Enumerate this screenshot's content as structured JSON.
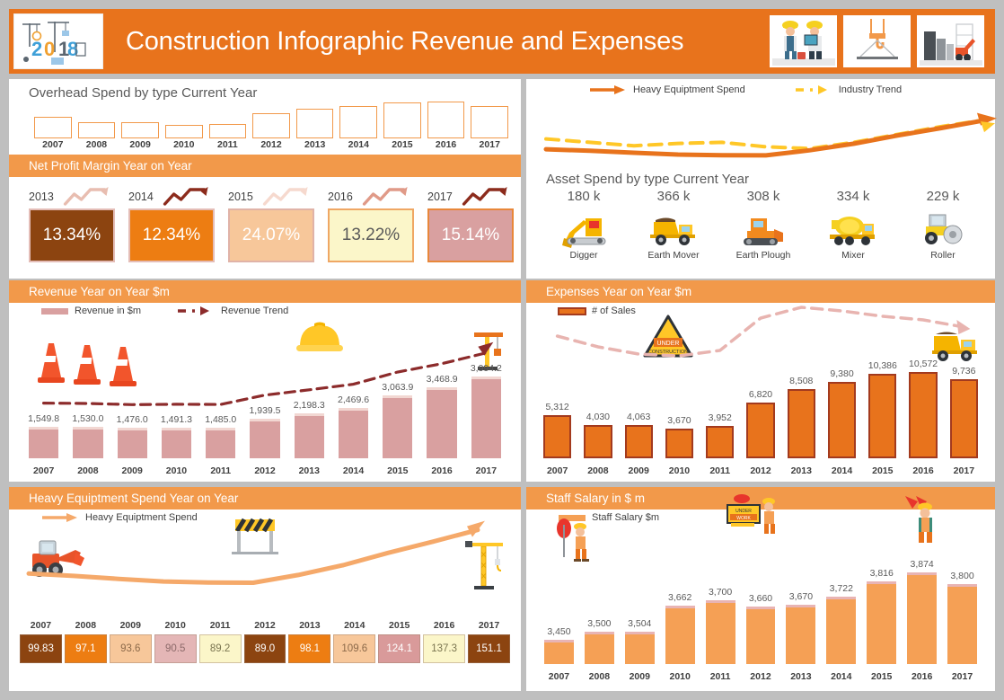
{
  "header": {
    "title": "Construction Infographic Revenue and Expenses",
    "logo_alt": "2018-construction-logo",
    "accent": "#E8731C",
    "thumbs": [
      {
        "name": "workers-blueprint-photo"
      },
      {
        "name": "crane-hook-photo"
      },
      {
        "name": "city-excavator-photo"
      }
    ]
  },
  "overhead": {
    "title": "Overhead Spend by type Current Year",
    "chart_data": {
      "type": "bar",
      "title": "Overhead Spend by type Current Year",
      "categories": [
        "2007",
        "2008",
        "2009",
        "2010",
        "2011",
        "2012",
        "2013",
        "2014",
        "2015",
        "2016",
        "2017"
      ],
      "values": [
        24,
        18,
        18,
        15,
        16,
        28,
        33,
        36,
        40,
        41,
        36
      ],
      "xlabel": "",
      "ylabel": "",
      "ylim": [
        0,
        42
      ],
      "grid": false,
      "legend": "none"
    }
  },
  "netprofit": {
    "band": "Net Profit Margin Year on Year",
    "chart_data": {
      "type": "heatmap",
      "title": "Net Profit Margin Year on Year",
      "categories": [
        "2013",
        "2014",
        "2015",
        "2016",
        "2017"
      ],
      "values": [
        13.34,
        12.34,
        24.07,
        13.22,
        15.14
      ],
      "labels": [
        "13.34%",
        "12.34%",
        "24.07%",
        "13.22%",
        "15.14%"
      ],
      "cell_colors": [
        "#8C4410",
        "#ED7D12",
        "#F7C79A",
        "#FBF6C9",
        "#D9A0A0"
      ],
      "text_colors": [
        "#ffffff",
        "#ffffff",
        "#ffffff",
        "#595959",
        "#ffffff"
      ],
      "border_colors": [
        "#E4BDB7",
        "#E4BDB7",
        "#E0B3A8",
        "#EFA764",
        "#E8873A"
      ],
      "arrow_colors": [
        "#E8BDB0",
        "#8C2B1C",
        "#F6D9CE",
        "#E09A88",
        "#8C2B1C"
      ]
    }
  },
  "trendpanel": {
    "legend": [
      {
        "label": "Heavy Equiptment Spend",
        "color": "#E8731C",
        "style": "solid-arrow"
      },
      {
        "label": "Industry Trend",
        "color": "#FFC727",
        "style": "dashed-arrow"
      }
    ],
    "chart_data": {
      "type": "line",
      "title": "",
      "series": [
        {
          "name": "Heavy Equiptment Spend",
          "color": "#E8731C",
          "style": "solid",
          "values": [
            99.83,
            97.1,
            93.6,
            90.5,
            89.2,
            89.0,
            98.1,
            109.6,
            124.1,
            137.3,
            151.1
          ]
        },
        {
          "name": "Industry Trend",
          "color": "#FFC727",
          "style": "dashed",
          "values": [
            118,
            112,
            106,
            110,
            112,
            104,
            101,
            112,
            126,
            140,
            152
          ]
        }
      ],
      "x": [
        "2007",
        "2008",
        "2009",
        "2010",
        "2011",
        "2012",
        "2013",
        "2014",
        "2015",
        "2016",
        "2017"
      ],
      "legend_position": "top",
      "grid": false
    }
  },
  "assets": {
    "title": "Asset Spend by type Current Year",
    "chart_data": {
      "type": "bar",
      "title": "Asset Spend by type Current Year",
      "categories": [
        "Digger",
        "Earth Mover",
        "Earth Plough",
        "Mixer",
        "Roller"
      ],
      "values": [
        180,
        366,
        308,
        334,
        229
      ],
      "labels": [
        "180 k",
        "366 k",
        "308 k",
        "334 k",
        "229 k"
      ],
      "icons": [
        "excavator-icon",
        "dump-truck-icon",
        "bulldozer-icon",
        "cement-mixer-icon",
        "road-roller-icon"
      ],
      "ylabel": "k",
      "xlabel": ""
    }
  },
  "revenue": {
    "band": "Revenue Year on Year $m",
    "legend": [
      {
        "label": "Revenue in $m",
        "color": "#D9A0A0",
        "style": "bar"
      },
      {
        "label": "Revenue Trend",
        "color": "#8C2B2B",
        "style": "dashed-arrow"
      }
    ],
    "icons": [
      "traffic-cone-icon",
      "hard-hat-icon",
      "crane-icon"
    ],
    "chart_data": {
      "type": "bar",
      "title": "Revenue Year on Year $m",
      "categories": [
        "2007",
        "2008",
        "2009",
        "2010",
        "2011",
        "2012",
        "2013",
        "2014",
        "2015",
        "2016",
        "2017"
      ],
      "values": [
        1549.8,
        1530.0,
        1476.0,
        1491.3,
        1485.0,
        1939.5,
        2198.3,
        2469.6,
        3063.9,
        3468.9,
        3994.2
      ],
      "labels": [
        "1,549.8",
        "1,530.0",
        "1,476.0",
        "1,491.3",
        "1,485.0",
        "1,939.5",
        "2,198.3",
        "2,469.6",
        "3,063.9",
        "3,468.9",
        "3,994.2"
      ],
      "series_name": "Revenue in $m",
      "trend_name": "Revenue Trend",
      "bar_color": "#D9A0A0",
      "bar_top_color": "#F2D7D2",
      "trend_color": "#8C2B2B",
      "xlabel": "",
      "ylabel": "$m",
      "ylim": [
        0,
        4200
      ],
      "grid": false
    }
  },
  "expenses": {
    "band": "Expenses Year on Year $m",
    "legend": [
      {
        "label": "# of Sales",
        "color": "#E8731C",
        "style": "bar"
      }
    ],
    "icons": [
      "under-construction-sign-icon",
      "dump-truck-icon"
    ],
    "chart_data": {
      "type": "bar",
      "title": "Expenses Year on Year $m",
      "categories": [
        "2007",
        "2008",
        "2009",
        "2010",
        "2011",
        "2012",
        "2013",
        "2014",
        "2015",
        "2016",
        "2017"
      ],
      "values": [
        5312,
        4030,
        4063,
        3670,
        3952,
        6820,
        8508,
        9380,
        10386,
        10572,
        9736
      ],
      "labels": [
        "5,312",
        "4,030",
        "4,063",
        "3,670",
        "3,952",
        "6,820",
        "8,508",
        "9,380",
        "10,386",
        "10,572",
        "9,736"
      ],
      "series_name": "# of Sales",
      "bar_color": "#E8731C",
      "bar_border_color": "#A33A1E",
      "trend_color": "#E8B4B0",
      "xlabel": "",
      "ylabel": "$m",
      "ylim": [
        0,
        11000
      ],
      "grid": false
    }
  },
  "heavy": {
    "band": "Heavy Equiptment Spend Year on Year",
    "legend": [
      {
        "label": "Heavy Equiptment Spend",
        "color": "#F5A96A",
        "style": "arrow"
      }
    ],
    "icons": [
      "wheel-loader-icon",
      "road-barrier-icon",
      "tower-crane-icon"
    ],
    "chart_data": {
      "type": "line",
      "title": "Heavy Equiptment Spend Year on Year",
      "categories": [
        "2007",
        "2008",
        "2009",
        "2010",
        "2011",
        "2012",
        "2013",
        "2014",
        "2015",
        "2016",
        "2017"
      ],
      "values": [
        99.83,
        97.1,
        93.6,
        90.5,
        89.2,
        89.0,
        98.1,
        109.6,
        124.1,
        137.3,
        151.1
      ],
      "labels": [
        "99.83",
        "97.1",
        "93.6",
        "90.5",
        "89.2",
        "89.0",
        "98.1",
        "109.6",
        "124.1",
        "137.3",
        "151.1"
      ],
      "cell_colors": [
        "#8C4410",
        "#ED7D12",
        "#F7C79A",
        "#E4B6B6",
        "#FBF6C9",
        "#8C4410",
        "#ED7D12",
        "#F7C79A",
        "#D99A9A",
        "#FBF6C9",
        "#8C4410"
      ],
      "text_colors": [
        "#ffffff",
        "#ffffff",
        "#8C6A4A",
        "#8C6A6A",
        "#7A7550",
        "#ffffff",
        "#ffffff",
        "#8C6A4A",
        "#ffffff",
        "#7A7550",
        "#ffffff"
      ],
      "line_color": "#F5A96A",
      "grid": false
    }
  },
  "staff": {
    "band": "Staff Salary in $ m",
    "legend": [
      {
        "label": "Staff Salary $m",
        "color": "#F5A055",
        "style": "bar"
      }
    ],
    "icons": [
      "worker-flag-icon",
      "construction-sign-worker-icon",
      "worker-megaphone-icon"
    ],
    "chart_data": {
      "type": "bar",
      "title": "Staff Salary in $ m",
      "categories": [
        "2007",
        "2008",
        "2009",
        "2010",
        "2011",
        "2012",
        "2013",
        "2014",
        "2015",
        "2016",
        "2017"
      ],
      "values": [
        3450,
        3500,
        3504,
        3662,
        3700,
        3660,
        3670,
        3722,
        3816,
        3874,
        3800
      ],
      "labels": [
        "3,450",
        "3,500",
        "3,504",
        "3,662",
        "3,700",
        "3,660",
        "3,670",
        "3,722",
        "3,816",
        "3,874",
        "3,800"
      ],
      "series_name": "Staff Salary $m",
      "bar_color": "#F5A055",
      "bar_top_color": "#E8B4B4",
      "xlabel": "",
      "ylabel": "$m",
      "ylim": [
        3300,
        3950
      ],
      "grid": false
    }
  }
}
